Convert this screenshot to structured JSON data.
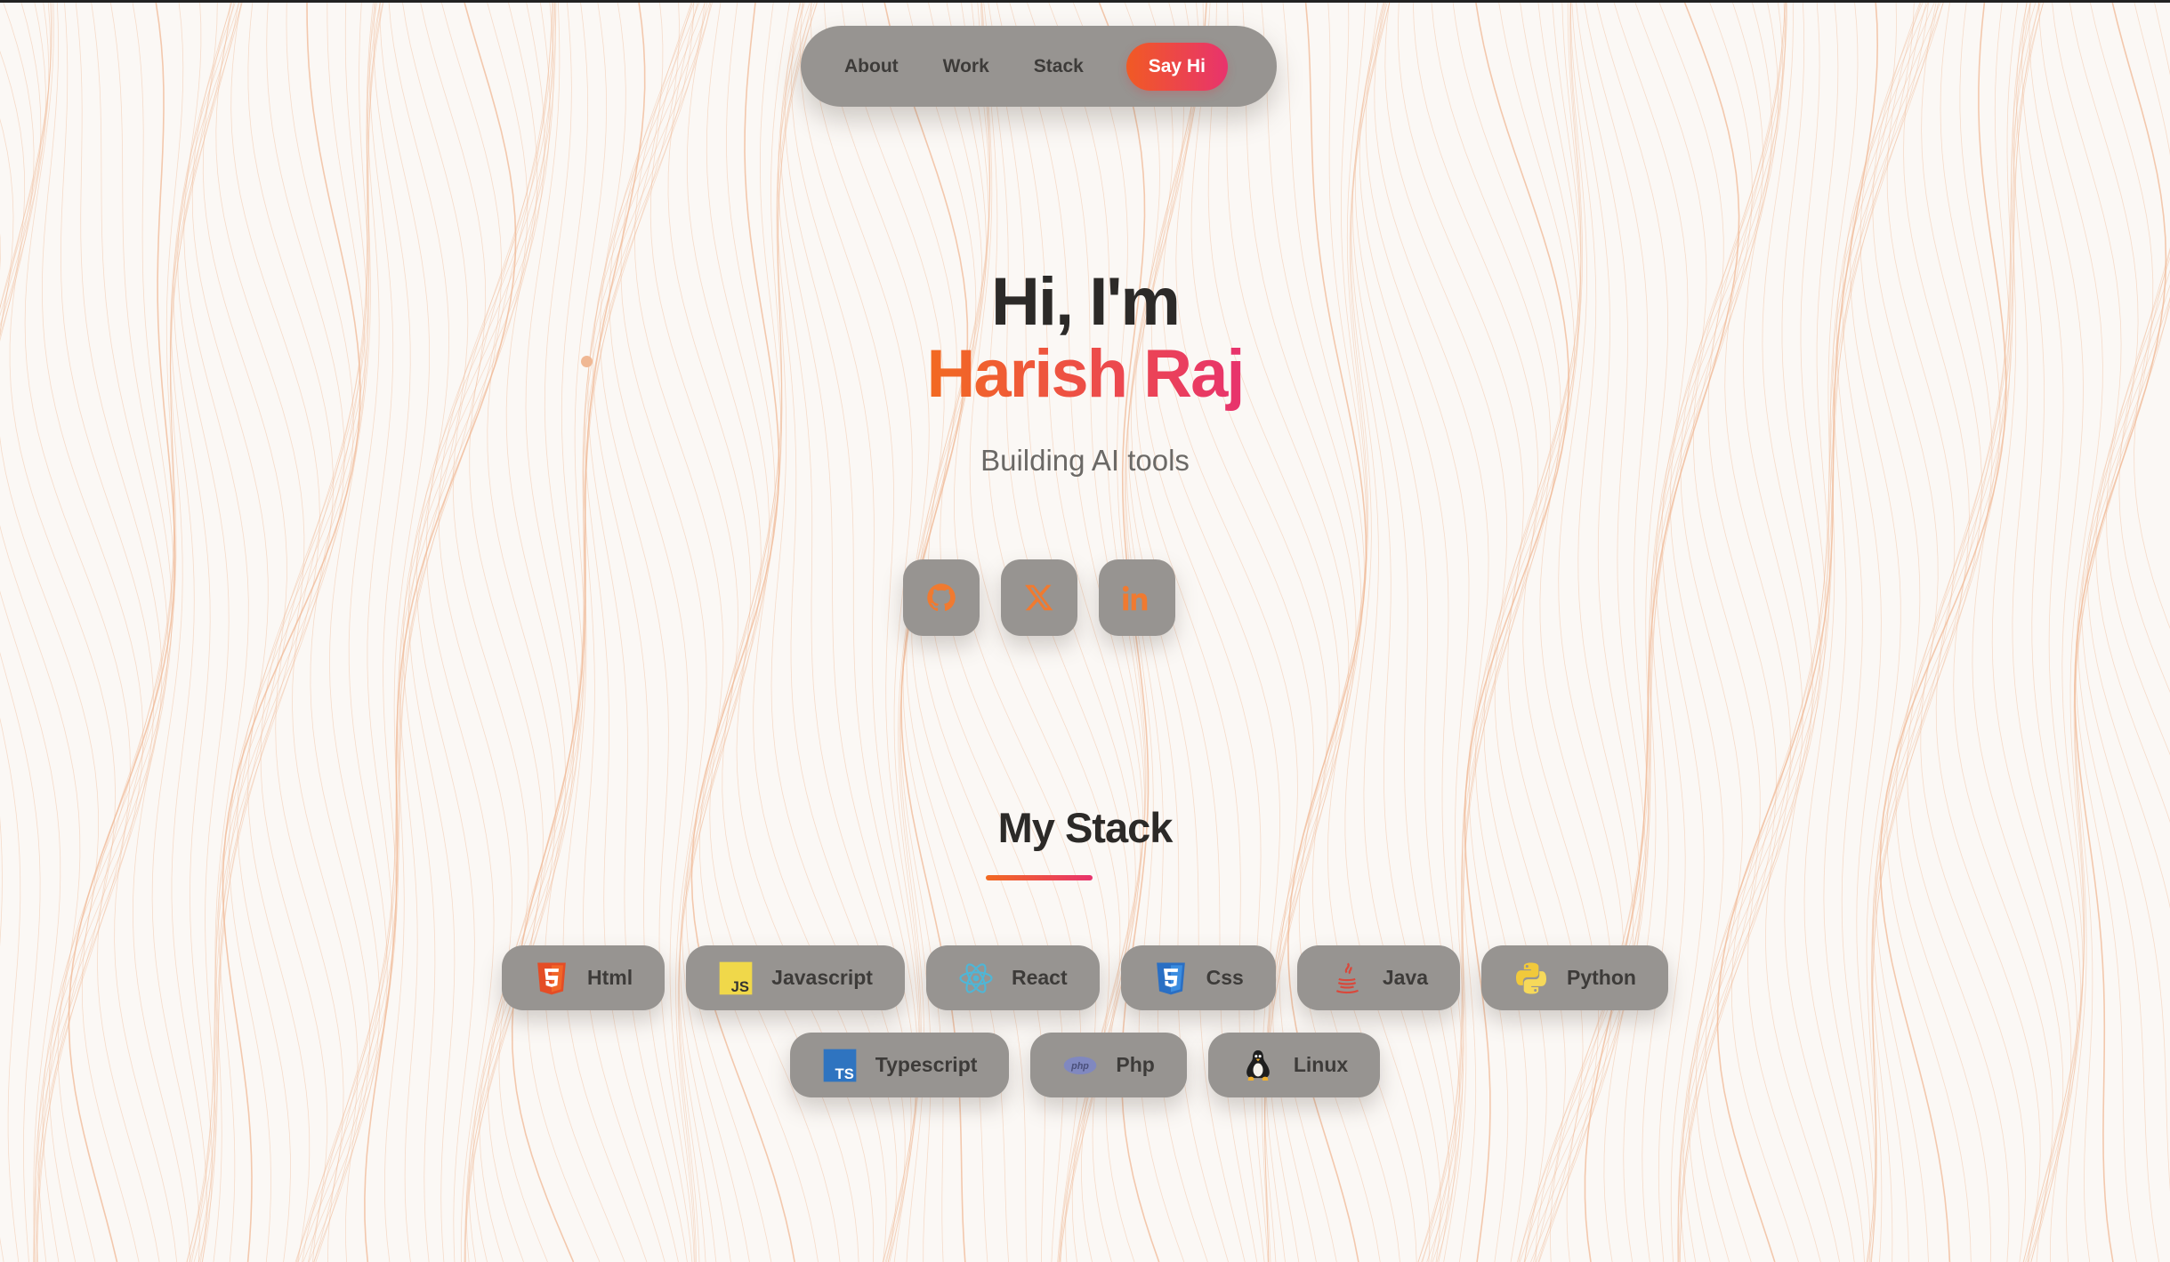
{
  "nav": {
    "links": [
      "About",
      "Work",
      "Stack"
    ],
    "cta_label": "Say Hi"
  },
  "hero": {
    "greeting": "Hi, I'm",
    "name": "Harish Raj",
    "tagline": "Building AI tools"
  },
  "socials": [
    {
      "icon": "github-icon"
    },
    {
      "icon": "x-icon"
    },
    {
      "icon": "linkedin-icon"
    }
  ],
  "stack": {
    "title": "My Stack",
    "items_row1": [
      "Html",
      "Javascript",
      "React",
      "Css",
      "Java",
      "Python"
    ],
    "items_row2": [
      "Typescript",
      "Php",
      "Linux"
    ]
  },
  "colors": {
    "accent_start": "#f26a21",
    "accent_end": "#e8336d",
    "pill_bg": "#979491",
    "text_dark": "#2c2a28",
    "background": "#fbf8f5",
    "wave_line": "#f0b894"
  }
}
